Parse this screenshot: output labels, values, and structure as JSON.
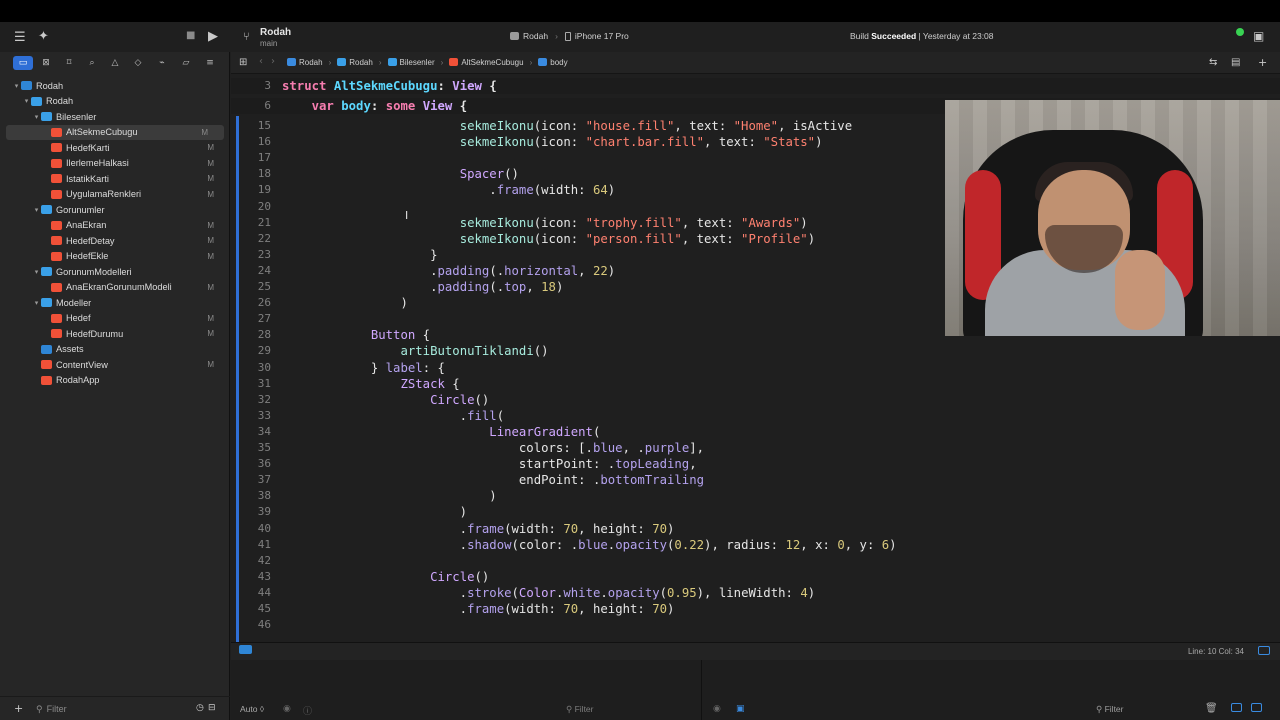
{
  "toolbar": {
    "project_name": "Rodah",
    "branch": "main",
    "scheme": "Rodah",
    "device": "iPhone 17 Pro",
    "status_prefix": "Build ",
    "status_bold": "Succeeded",
    "status_suffix": " | Yesterday at 23:08"
  },
  "navigator": {
    "items": [
      {
        "label": "Rodah",
        "level": 0,
        "kind": "project",
        "expanded": true,
        "mark": ""
      },
      {
        "label": "Rodah",
        "level": 1,
        "kind": "folder",
        "expanded": true,
        "mark": ""
      },
      {
        "label": "Bilesenler",
        "level": 2,
        "kind": "folder",
        "expanded": true,
        "mark": ""
      },
      {
        "label": "AltSekmeCubugu",
        "level": 3,
        "kind": "swift",
        "mark": "M",
        "selected": true
      },
      {
        "label": "HedefKarti",
        "level": 3,
        "kind": "swift",
        "mark": "M"
      },
      {
        "label": "IlerlemeHalkasi",
        "level": 3,
        "kind": "swift",
        "mark": "M"
      },
      {
        "label": "IstatikKarti",
        "level": 3,
        "kind": "swift",
        "mark": "M"
      },
      {
        "label": "UygulamaRenkleri",
        "level": 3,
        "kind": "swift",
        "mark": "M"
      },
      {
        "label": "Gorunumler",
        "level": 2,
        "kind": "folder",
        "expanded": true,
        "mark": ""
      },
      {
        "label": "AnaEkran",
        "level": 3,
        "kind": "swift",
        "mark": "M"
      },
      {
        "label": "HedefDetay",
        "level": 3,
        "kind": "swift",
        "mark": "M"
      },
      {
        "label": "HedefEkle",
        "level": 3,
        "kind": "swift",
        "mark": "M"
      },
      {
        "label": "GorunumModelleri",
        "level": 2,
        "kind": "folder",
        "expanded": true,
        "mark": ""
      },
      {
        "label": "AnaEkranGorunumModeli",
        "level": 3,
        "kind": "swift",
        "mark": "M"
      },
      {
        "label": "Modeller",
        "level": 2,
        "kind": "folder",
        "expanded": true,
        "mark": ""
      },
      {
        "label": "Hedef",
        "level": 3,
        "kind": "swift",
        "mark": "M"
      },
      {
        "label": "HedefDurumu",
        "level": 3,
        "kind": "swift",
        "mark": "M"
      },
      {
        "label": "Assets",
        "level": 2,
        "kind": "assets",
        "mark": ""
      },
      {
        "label": "ContentView",
        "level": 2,
        "kind": "swift",
        "mark": "M"
      },
      {
        "label": "RodahApp",
        "level": 2,
        "kind": "swift",
        "mark": ""
      }
    ],
    "filter_placeholder": "Filter"
  },
  "jumpbar": {
    "crumbs": [
      "Rodah",
      "Rodah",
      "Bilesenler",
      "AltSekmeCubugu",
      "body"
    ]
  },
  "editor": {
    "sticky": [
      {
        "n": "3",
        "segs": [
          [
            "kw",
            "struct "
          ],
          [
            "decl",
            "AltSekmeCubugu"
          ],
          [
            "pl",
            ": "
          ],
          [
            "ty",
            "View"
          ],
          [
            "pl",
            " {"
          ]
        ]
      },
      {
        "n": "6",
        "segs": [
          [
            "pl",
            "    "
          ],
          [
            "kw",
            "var "
          ],
          [
            "decl",
            "body"
          ],
          [
            "pl",
            ": "
          ],
          [
            "kw",
            "some "
          ],
          [
            "ty",
            "View"
          ],
          [
            "pl",
            " {"
          ]
        ]
      }
    ],
    "lines": [
      {
        "n": "15",
        "segs": [
          [
            "pl",
            "                        "
          ],
          [
            "fn",
            "sekmeIkonu"
          ],
          [
            "pl",
            "(icon: "
          ],
          [
            "st",
            "\"house.fill\""
          ],
          [
            "pl",
            ", text: "
          ],
          [
            "st",
            "\"Home\""
          ],
          [
            "pl",
            ", isActive"
          ]
        ]
      },
      {
        "n": "16",
        "segs": [
          [
            "pl",
            "                        "
          ],
          [
            "fn",
            "sekmeIkonu"
          ],
          [
            "pl",
            "(icon: "
          ],
          [
            "st",
            "\"chart.bar.fill\""
          ],
          [
            "pl",
            ", text: "
          ],
          [
            "st",
            "\"Stats\""
          ],
          [
            "pl",
            ")"
          ]
        ]
      },
      {
        "n": "17",
        "segs": [
          [
            "pl",
            ""
          ]
        ]
      },
      {
        "n": "18",
        "segs": [
          [
            "pl",
            "                        "
          ],
          [
            "ty",
            "Spacer"
          ],
          [
            "pl",
            "()"
          ]
        ]
      },
      {
        "n": "19",
        "segs": [
          [
            "pl",
            "                            ."
          ],
          [
            "me",
            "frame"
          ],
          [
            "pl",
            "(width: "
          ],
          [
            "nu",
            "64"
          ],
          [
            "pl",
            ")"
          ]
        ]
      },
      {
        "n": "20",
        "segs": [
          [
            "pl",
            ""
          ]
        ]
      },
      {
        "n": "21",
        "segs": [
          [
            "pl",
            "                        "
          ],
          [
            "fn",
            "sekmeIkonu"
          ],
          [
            "pl",
            "(icon: "
          ],
          [
            "st",
            "\"trophy.fill\""
          ],
          [
            "pl",
            ", text: "
          ],
          [
            "st",
            "\"Awards\""
          ],
          [
            "pl",
            ")"
          ]
        ]
      },
      {
        "n": "22",
        "segs": [
          [
            "pl",
            "                        "
          ],
          [
            "fn",
            "sekmeIkonu"
          ],
          [
            "pl",
            "(icon: "
          ],
          [
            "st",
            "\"person.fill\""
          ],
          [
            "pl",
            ", text: "
          ],
          [
            "st",
            "\"Profile\""
          ],
          [
            "pl",
            ")"
          ]
        ]
      },
      {
        "n": "23",
        "segs": [
          [
            "pl",
            "                    }"
          ]
        ]
      },
      {
        "n": "24",
        "segs": [
          [
            "pl",
            "                    ."
          ],
          [
            "me",
            "padding"
          ],
          [
            "pl",
            "(."
          ],
          [
            "me",
            "horizontal"
          ],
          [
            "pl",
            ", "
          ],
          [
            "nu",
            "22"
          ],
          [
            "pl",
            ")"
          ]
        ]
      },
      {
        "n": "25",
        "segs": [
          [
            "pl",
            "                    ."
          ],
          [
            "me",
            "padding"
          ],
          [
            "pl",
            "(."
          ],
          [
            "me",
            "top"
          ],
          [
            "pl",
            ", "
          ],
          [
            "nu",
            "18"
          ],
          [
            "pl",
            ")"
          ]
        ]
      },
      {
        "n": "26",
        "segs": [
          [
            "pl",
            "                )"
          ]
        ]
      },
      {
        "n": "27",
        "segs": [
          [
            "pl",
            ""
          ]
        ]
      },
      {
        "n": "28",
        "segs": [
          [
            "pl",
            "            "
          ],
          [
            "ty",
            "Button"
          ],
          [
            "pl",
            " {"
          ]
        ]
      },
      {
        "n": "29",
        "segs": [
          [
            "pl",
            "                "
          ],
          [
            "fn",
            "artiButonuTiklandi"
          ],
          [
            "pl",
            "()"
          ]
        ]
      },
      {
        "n": "30",
        "segs": [
          [
            "pl",
            "            } "
          ],
          [
            "me",
            "label"
          ],
          [
            "pl",
            ": {"
          ]
        ]
      },
      {
        "n": "31",
        "segs": [
          [
            "pl",
            "                "
          ],
          [
            "ty",
            "ZStack"
          ],
          [
            "pl",
            " {"
          ]
        ]
      },
      {
        "n": "32",
        "segs": [
          [
            "pl",
            "                    "
          ],
          [
            "ty",
            "Circle"
          ],
          [
            "pl",
            "()"
          ]
        ]
      },
      {
        "n": "33",
        "segs": [
          [
            "pl",
            "                        ."
          ],
          [
            "me",
            "fill"
          ],
          [
            "pl",
            "("
          ]
        ]
      },
      {
        "n": "34",
        "segs": [
          [
            "pl",
            "                            "
          ],
          [
            "ty",
            "LinearGradient"
          ],
          [
            "pl",
            "("
          ]
        ]
      },
      {
        "n": "35",
        "segs": [
          [
            "pl",
            "                                colors: [."
          ],
          [
            "me",
            "blue"
          ],
          [
            "pl",
            ", ."
          ],
          [
            "me",
            "purple"
          ],
          [
            "pl",
            "],"
          ]
        ]
      },
      {
        "n": "36",
        "segs": [
          [
            "pl",
            "                                startPoint: ."
          ],
          [
            "me",
            "topLeading"
          ],
          [
            "pl",
            ","
          ]
        ]
      },
      {
        "n": "37",
        "segs": [
          [
            "pl",
            "                                endPoint: ."
          ],
          [
            "me",
            "bottomTrailing"
          ]
        ]
      },
      {
        "n": "38",
        "segs": [
          [
            "pl",
            "                            )"
          ]
        ]
      },
      {
        "n": "39",
        "segs": [
          [
            "pl",
            "                        )"
          ]
        ]
      },
      {
        "n": "40",
        "segs": [
          [
            "pl",
            "                        ."
          ],
          [
            "me",
            "frame"
          ],
          [
            "pl",
            "(width: "
          ],
          [
            "nu",
            "70"
          ],
          [
            "pl",
            ", height: "
          ],
          [
            "nu",
            "70"
          ],
          [
            "pl",
            ")"
          ]
        ]
      },
      {
        "n": "41",
        "segs": [
          [
            "pl",
            "                        ."
          ],
          [
            "me",
            "shadow"
          ],
          [
            "pl",
            "(color: ."
          ],
          [
            "me",
            "blue"
          ],
          [
            "pl",
            "."
          ],
          [
            "me",
            "opacity"
          ],
          [
            "pl",
            "("
          ],
          [
            "nu",
            "0.22"
          ],
          [
            "pl",
            "), radius: "
          ],
          [
            "nu",
            "12"
          ],
          [
            "pl",
            ", x: "
          ],
          [
            "nu",
            "0"
          ],
          [
            "pl",
            ", y: "
          ],
          [
            "nu",
            "6"
          ],
          [
            "pl",
            ")"
          ]
        ]
      },
      {
        "n": "42",
        "segs": [
          [
            "pl",
            ""
          ]
        ]
      },
      {
        "n": "43",
        "segs": [
          [
            "pl",
            "                    "
          ],
          [
            "ty",
            "Circle"
          ],
          [
            "pl",
            "()"
          ]
        ]
      },
      {
        "n": "44",
        "segs": [
          [
            "pl",
            "                        ."
          ],
          [
            "me",
            "stroke"
          ],
          [
            "pl",
            "("
          ],
          [
            "ty",
            "Color"
          ],
          [
            "pl",
            "."
          ],
          [
            "me",
            "white"
          ],
          [
            "pl",
            "."
          ],
          [
            "me",
            "opacity"
          ],
          [
            "pl",
            "("
          ],
          [
            "nu",
            "0.95"
          ],
          [
            "pl",
            "), lineWidth: "
          ],
          [
            "nu",
            "4"
          ],
          [
            "pl",
            ")"
          ]
        ]
      },
      {
        "n": "45",
        "segs": [
          [
            "pl",
            "                        ."
          ],
          [
            "me",
            "frame"
          ],
          [
            "pl",
            "(width: "
          ],
          [
            "nu",
            "70"
          ],
          [
            "pl",
            ", height: "
          ],
          [
            "nu",
            "70"
          ],
          [
            "pl",
            ")"
          ]
        ]
      },
      {
        "n": "46",
        "segs": [
          [
            "pl",
            ""
          ]
        ]
      }
    ]
  },
  "statusbar": {
    "line_col": "Line: 10  Col: 34"
  },
  "debug": {
    "auto_label": "Auto",
    "filter1": "Filter",
    "filter2": "Filter"
  }
}
